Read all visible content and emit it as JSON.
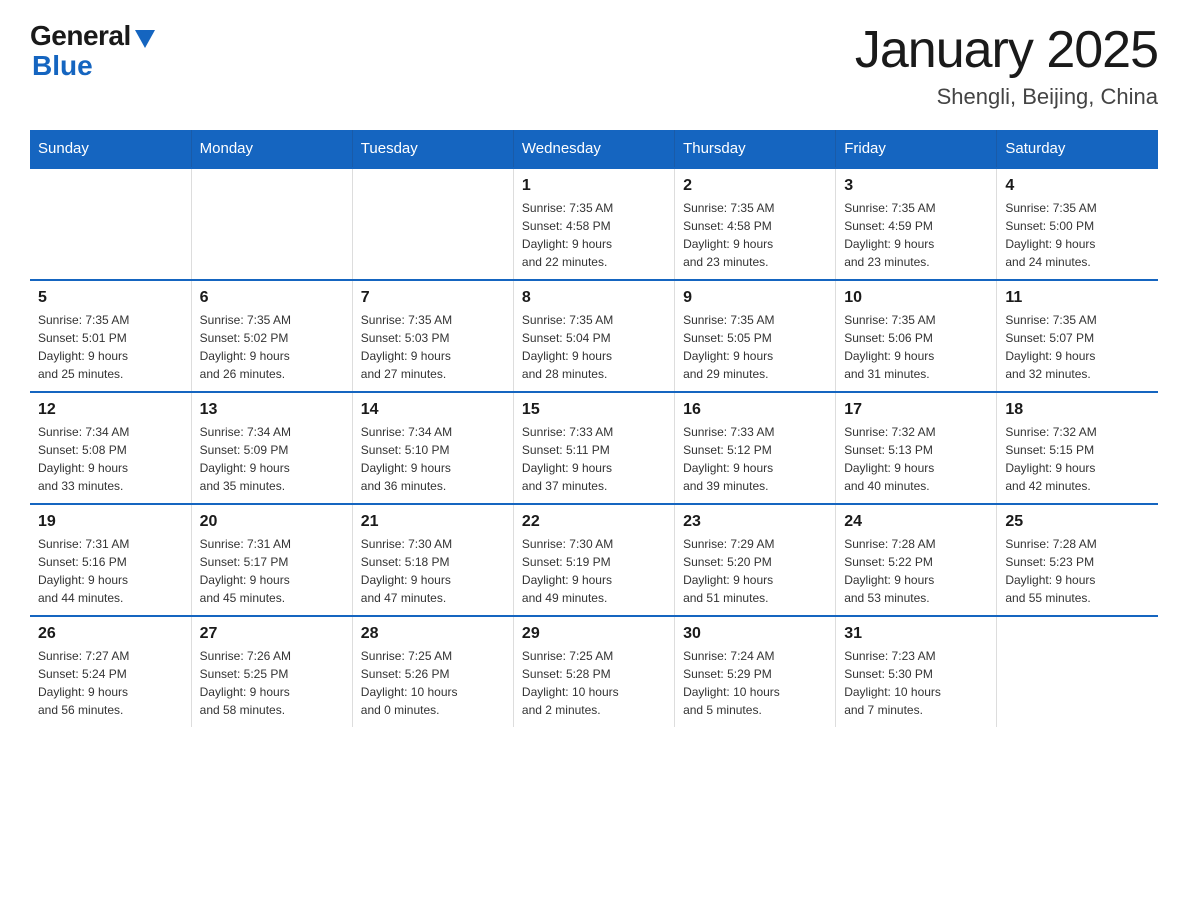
{
  "header": {
    "logo_general": "General",
    "logo_blue": "Blue",
    "title": "January 2025",
    "subtitle": "Shengli, Beijing, China"
  },
  "days_of_week": [
    "Sunday",
    "Monday",
    "Tuesday",
    "Wednesday",
    "Thursday",
    "Friday",
    "Saturday"
  ],
  "weeks": [
    [
      {
        "day": "",
        "info": ""
      },
      {
        "day": "",
        "info": ""
      },
      {
        "day": "",
        "info": ""
      },
      {
        "day": "1",
        "info": "Sunrise: 7:35 AM\nSunset: 4:58 PM\nDaylight: 9 hours\nand 22 minutes."
      },
      {
        "day": "2",
        "info": "Sunrise: 7:35 AM\nSunset: 4:58 PM\nDaylight: 9 hours\nand 23 minutes."
      },
      {
        "day": "3",
        "info": "Sunrise: 7:35 AM\nSunset: 4:59 PM\nDaylight: 9 hours\nand 23 minutes."
      },
      {
        "day": "4",
        "info": "Sunrise: 7:35 AM\nSunset: 5:00 PM\nDaylight: 9 hours\nand 24 minutes."
      }
    ],
    [
      {
        "day": "5",
        "info": "Sunrise: 7:35 AM\nSunset: 5:01 PM\nDaylight: 9 hours\nand 25 minutes."
      },
      {
        "day": "6",
        "info": "Sunrise: 7:35 AM\nSunset: 5:02 PM\nDaylight: 9 hours\nand 26 minutes."
      },
      {
        "day": "7",
        "info": "Sunrise: 7:35 AM\nSunset: 5:03 PM\nDaylight: 9 hours\nand 27 minutes."
      },
      {
        "day": "8",
        "info": "Sunrise: 7:35 AM\nSunset: 5:04 PM\nDaylight: 9 hours\nand 28 minutes."
      },
      {
        "day": "9",
        "info": "Sunrise: 7:35 AM\nSunset: 5:05 PM\nDaylight: 9 hours\nand 29 minutes."
      },
      {
        "day": "10",
        "info": "Sunrise: 7:35 AM\nSunset: 5:06 PM\nDaylight: 9 hours\nand 31 minutes."
      },
      {
        "day": "11",
        "info": "Sunrise: 7:35 AM\nSunset: 5:07 PM\nDaylight: 9 hours\nand 32 minutes."
      }
    ],
    [
      {
        "day": "12",
        "info": "Sunrise: 7:34 AM\nSunset: 5:08 PM\nDaylight: 9 hours\nand 33 minutes."
      },
      {
        "day": "13",
        "info": "Sunrise: 7:34 AM\nSunset: 5:09 PM\nDaylight: 9 hours\nand 35 minutes."
      },
      {
        "day": "14",
        "info": "Sunrise: 7:34 AM\nSunset: 5:10 PM\nDaylight: 9 hours\nand 36 minutes."
      },
      {
        "day": "15",
        "info": "Sunrise: 7:33 AM\nSunset: 5:11 PM\nDaylight: 9 hours\nand 37 minutes."
      },
      {
        "day": "16",
        "info": "Sunrise: 7:33 AM\nSunset: 5:12 PM\nDaylight: 9 hours\nand 39 minutes."
      },
      {
        "day": "17",
        "info": "Sunrise: 7:32 AM\nSunset: 5:13 PM\nDaylight: 9 hours\nand 40 minutes."
      },
      {
        "day": "18",
        "info": "Sunrise: 7:32 AM\nSunset: 5:15 PM\nDaylight: 9 hours\nand 42 minutes."
      }
    ],
    [
      {
        "day": "19",
        "info": "Sunrise: 7:31 AM\nSunset: 5:16 PM\nDaylight: 9 hours\nand 44 minutes."
      },
      {
        "day": "20",
        "info": "Sunrise: 7:31 AM\nSunset: 5:17 PM\nDaylight: 9 hours\nand 45 minutes."
      },
      {
        "day": "21",
        "info": "Sunrise: 7:30 AM\nSunset: 5:18 PM\nDaylight: 9 hours\nand 47 minutes."
      },
      {
        "day": "22",
        "info": "Sunrise: 7:30 AM\nSunset: 5:19 PM\nDaylight: 9 hours\nand 49 minutes."
      },
      {
        "day": "23",
        "info": "Sunrise: 7:29 AM\nSunset: 5:20 PM\nDaylight: 9 hours\nand 51 minutes."
      },
      {
        "day": "24",
        "info": "Sunrise: 7:28 AM\nSunset: 5:22 PM\nDaylight: 9 hours\nand 53 minutes."
      },
      {
        "day": "25",
        "info": "Sunrise: 7:28 AM\nSunset: 5:23 PM\nDaylight: 9 hours\nand 55 minutes."
      }
    ],
    [
      {
        "day": "26",
        "info": "Sunrise: 7:27 AM\nSunset: 5:24 PM\nDaylight: 9 hours\nand 56 minutes."
      },
      {
        "day": "27",
        "info": "Sunrise: 7:26 AM\nSunset: 5:25 PM\nDaylight: 9 hours\nand 58 minutes."
      },
      {
        "day": "28",
        "info": "Sunrise: 7:25 AM\nSunset: 5:26 PM\nDaylight: 10 hours\nand 0 minutes."
      },
      {
        "day": "29",
        "info": "Sunrise: 7:25 AM\nSunset: 5:28 PM\nDaylight: 10 hours\nand 2 minutes."
      },
      {
        "day": "30",
        "info": "Sunrise: 7:24 AM\nSunset: 5:29 PM\nDaylight: 10 hours\nand 5 minutes."
      },
      {
        "day": "31",
        "info": "Sunrise: 7:23 AM\nSunset: 5:30 PM\nDaylight: 10 hours\nand 7 minutes."
      },
      {
        "day": "",
        "info": ""
      }
    ]
  ]
}
